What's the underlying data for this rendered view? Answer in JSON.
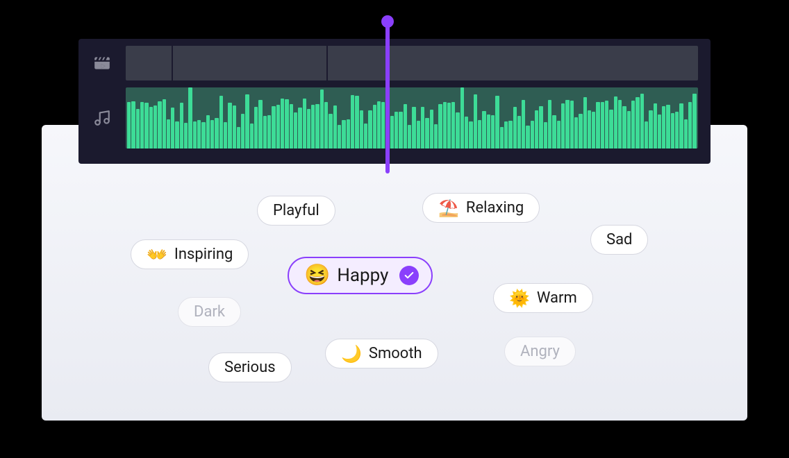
{
  "timeline": {
    "video_segments": [
      8,
      27,
      65
    ],
    "waveform_seed": 73,
    "playhead_position_pct": 48
  },
  "tags": {
    "playful": {
      "label": "Playful",
      "emoji": "",
      "muted": false,
      "selected": false
    },
    "relaxing": {
      "label": "Relaxing",
      "emoji": "⛱️",
      "muted": false,
      "selected": false
    },
    "inspiring": {
      "label": "Inspiring",
      "emoji": "👐",
      "muted": false,
      "selected": false
    },
    "sad": {
      "label": "Sad",
      "emoji": "",
      "muted": false,
      "selected": false
    },
    "happy": {
      "label": "Happy",
      "emoji": "😆",
      "muted": false,
      "selected": true
    },
    "dark": {
      "label": "Dark",
      "emoji": "",
      "muted": true,
      "selected": false
    },
    "warm": {
      "label": "Warm",
      "emoji": "🌞",
      "muted": false,
      "selected": false
    },
    "serious": {
      "label": "Serious",
      "emoji": "",
      "muted": false,
      "selected": false
    },
    "smooth": {
      "label": "Smooth",
      "emoji": "🌙",
      "muted": false,
      "selected": false
    },
    "angry": {
      "label": "Angry",
      "emoji": "",
      "muted": true,
      "selected": false
    }
  },
  "colors": {
    "accent": "#8a3ffc",
    "waveform": "#3ddc97"
  }
}
